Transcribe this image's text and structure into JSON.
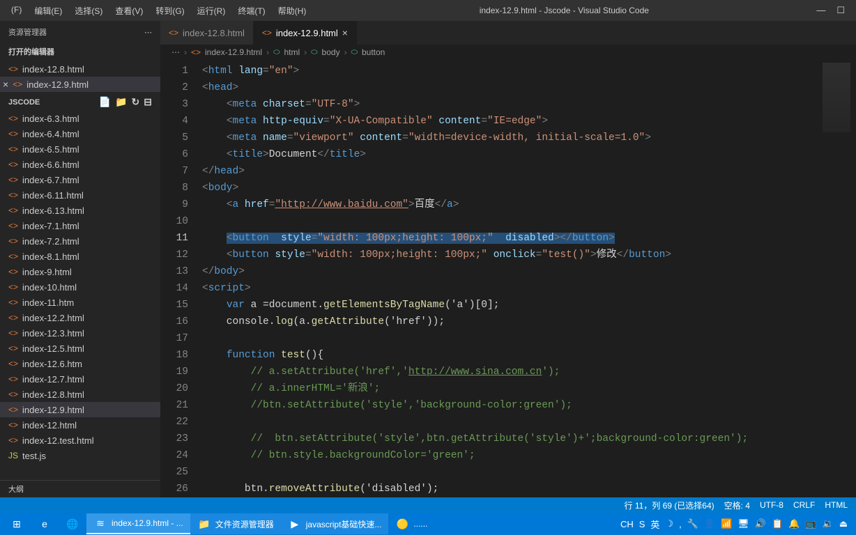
{
  "titlebar": {
    "menu": [
      "(F)",
      "编辑(E)",
      "选择(S)",
      "查看(V)",
      "转到(G)",
      "运行(R)",
      "终端(T)",
      "帮助(H)"
    ],
    "title": "index-12.9.html - Jscode - Visual Studio Code"
  },
  "sidebar": {
    "title": "资源管理器",
    "open_editors_label": "打开的编辑器",
    "open_editors": [
      {
        "name": "index-12.8.html",
        "modified": false
      },
      {
        "name": "index-12.9.html",
        "modified": true
      }
    ],
    "workspace_label": "JSCODE",
    "files": [
      "index-6.3.html",
      "index-6.4.html",
      "index-6.5.html",
      "index-6.6.html",
      "index-6.7.html",
      "index-6.11.html",
      "index-6.13.html",
      "index-7.1.html",
      "index-7.2.html",
      "index-8.1.html",
      "index-9.html",
      "index-10.html",
      "index-11.htm",
      "index-12.2.html",
      "index-12.3.html",
      "index-12.5.html",
      "index-12.6.htm",
      "index-12.7.html",
      "index-12.8.html",
      "index-12.9.html",
      "index-12.html",
      "index-12.test.html",
      "test.js"
    ],
    "active_file": "index-12.9.html",
    "outline_label": "大纲"
  },
  "tabs": [
    {
      "name": "index-12.8.html",
      "active": false
    },
    {
      "name": "index-12.9.html",
      "active": true
    }
  ],
  "breadcrumb": [
    "index-12.9.html",
    "html",
    "body",
    "button"
  ],
  "editor": {
    "current_line": 11,
    "lines": [
      1,
      2,
      3,
      4,
      5,
      6,
      7,
      8,
      9,
      10,
      11,
      12,
      13,
      14,
      15,
      16,
      17,
      18,
      19,
      20,
      21,
      22,
      23,
      24,
      25,
      26
    ]
  },
  "code": {
    "l1_lang": "lang",
    "l1_en": "\"en\"",
    "l3_charset": "charset",
    "l3_utf8": "\"UTF-8\"",
    "l4_httpequiv": "http-equiv",
    "l4_xua": "\"X-UA-Compatible\"",
    "l4_content": "content",
    "l4_ie": "\"IE=edge\"",
    "l5_name": "name",
    "l5_vp": "\"viewport\"",
    "l5_content": "content",
    "l5_vpval": "\"width=device-width, initial-scale=1.0\"",
    "l6_doc": "Document",
    "l9_href": "href",
    "l9_url": "\"http://www.baidu.com\"",
    "l9_baidu": "百度",
    "l11_style": "style",
    "l11_val": "\"width: 100px;height: 100px;\"",
    "l11_disabled": "disabled",
    "l12_style": "style",
    "l12_val": "\"width: 100px;height: 100px;\"",
    "l12_onclick": "onclick",
    "l12_test": "\"test()\"",
    "l12_txt": "修改",
    "l15_var": "var",
    "l15_a": " a =document.",
    "l15_fn": "getElementsByTagName",
    "l15_args": "('a')[0];",
    "l16_console": "console.",
    "l16_log": "log",
    "l16_rest": "(a.",
    "l16_get": "getAttribute",
    "l16_args": "('href'));",
    "l18_fn": "function",
    "l18_test": " test",
    "l18_rest": "(){",
    "l19": "// a.setAttribute('href','",
    "l19_url": "http://www.sina.com.cn",
    "l19_end": "');",
    "l20": "// a.innerHTML='新浪';",
    "l21": "//btn.setAttribute('style','background-color:green');",
    "l23": "//  btn.setAttribute('style',btn.getAttribute('style')+';background-color:green');",
    "l24": "// btn.style.backgroundColor='green';",
    "l26_btn": "btn.",
    "l26_fn": "removeAttribute",
    "l26_args": "('disabled');"
  },
  "statusbar": {
    "pos": "行 11，列 69 (已选择64)",
    "spaces": "空格: 4",
    "encoding": "UTF-8",
    "eol": "CRLF",
    "lang": "HTML"
  },
  "taskbar": {
    "items": [
      {
        "icon": "⊞",
        "label": ""
      },
      {
        "icon": "e",
        "label": ""
      },
      {
        "icon": "🌐",
        "label": ""
      },
      {
        "icon": "≋",
        "label": "index-12.9.html - ...",
        "active": true
      },
      {
        "icon": "📁",
        "label": "文件资源管理器",
        "running": true
      },
      {
        "icon": "▶",
        "label": "javascript基础快速...",
        "running": true
      },
      {
        "icon": "🟡",
        "label": "......"
      }
    ],
    "tray": [
      "CH",
      "S",
      "英",
      "☽",
      ",",
      "🔧",
      "👤",
      "📶",
      "🖥",
      "🔊",
      "📋",
      "🔔",
      "📺",
      "🔉",
      "⏏"
    ]
  }
}
